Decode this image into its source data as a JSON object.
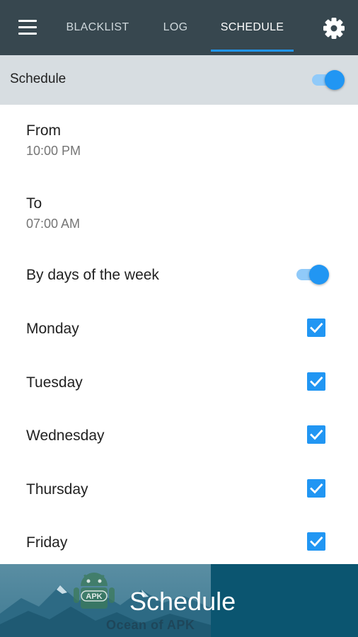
{
  "toolbar": {
    "tabs": [
      "BLACKLIST",
      "LOG",
      "SCHEDULE"
    ],
    "active_tab": "SCHEDULE"
  },
  "schedule_header": {
    "label": "Schedule",
    "enabled": true
  },
  "from": {
    "label": "From",
    "time": "10:00 PM"
  },
  "to": {
    "label": "To",
    "time": "07:00 AM"
  },
  "by_days": {
    "label": "By days of the week",
    "enabled": true
  },
  "days": [
    {
      "label": "Monday",
      "checked": true
    },
    {
      "label": "Tuesday",
      "checked": true
    },
    {
      "label": "Wednesday",
      "checked": true
    },
    {
      "label": "Thursday",
      "checked": true
    },
    {
      "label": "Friday",
      "checked": true
    }
  ],
  "banner": {
    "title": "Schedule",
    "watermark_badge": "APK",
    "watermark_text": "Ocean of APK"
  },
  "colors": {
    "toolbar": "#37474f",
    "accent": "#2196f3",
    "header_row": "#d7dde1",
    "banner": "#0b5570"
  }
}
